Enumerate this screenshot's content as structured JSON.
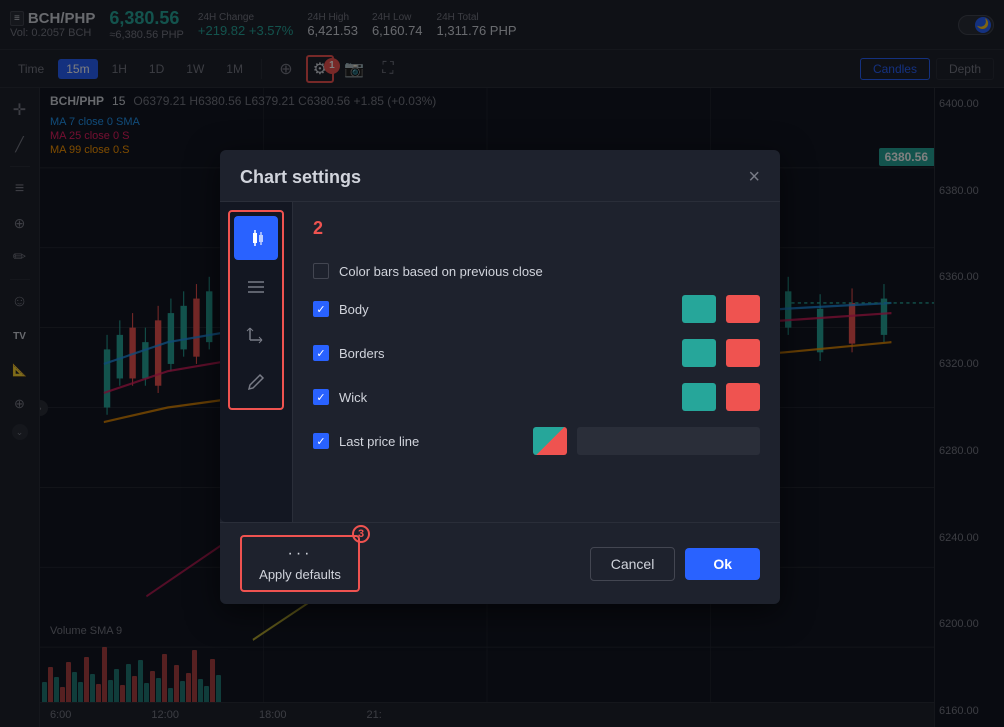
{
  "topbar": {
    "symbol_icon": "≡",
    "symbol": "BCH/PHP",
    "volume": "Vol: 0.2057 BCH",
    "price": "6,380.56",
    "price_approx": "≈6,380.56 PHP",
    "change_24h_label": "24H Change",
    "change_24h_value": "+219.82",
    "change_24h_pct": "+3.57%",
    "high_label": "24H High",
    "high_value": "6,421.53",
    "low_label": "24H Low",
    "low_value": "6,160.74",
    "total_label": "24H Total",
    "total_value": "1,311.76 PHP"
  },
  "toolbar": {
    "times": [
      "Time",
      "15m",
      "1H",
      "1D",
      "1W",
      "1M"
    ],
    "active_time": "15m",
    "candles_label": "Candles",
    "depth_label": "Depth"
  },
  "chart": {
    "pair": "BCH/PHP",
    "interval": "15",
    "ohlc": "O6379.21  H6380.56  L6379.21  C6380.56  +1.85 (+0.03%)",
    "ma7": "MA 7 close 0 SMA",
    "ma25": "MA 25 close 0 S",
    "ma99": "MA 99 close 0.S",
    "price_badge": "6380.56",
    "price_levels": [
      "6400.00",
      "6380.00",
      "6360.00",
      "6320.00",
      "6280.00",
      "6240.00",
      "6200.00",
      "6160.00"
    ],
    "time_labels": [
      "6:00",
      "12:00",
      "18:00",
      "21:"
    ],
    "volume_label": "Volume SMA 9",
    "watermark": "TV"
  },
  "modal": {
    "title": "Chart settings",
    "close_label": "×",
    "tabs": [
      {
        "id": "candles",
        "icon": "candle",
        "active": true
      },
      {
        "id": "lines",
        "icon": "lines",
        "active": false
      },
      {
        "id": "axes",
        "icon": "axes",
        "active": false
      },
      {
        "id": "pencil",
        "icon": "pencil",
        "active": false
      }
    ],
    "section_number": "2",
    "color_bars_label": "Color bars based on previous close",
    "color_bars_checked": false,
    "rows": [
      {
        "id": "body",
        "label": "Body",
        "checked": true,
        "color1": "green",
        "color2": "red"
      },
      {
        "id": "borders",
        "label": "Borders",
        "checked": true,
        "color1": "green",
        "color2": "red"
      },
      {
        "id": "wick",
        "label": "Wick",
        "checked": true,
        "color1": "green",
        "color2": "red"
      },
      {
        "id": "last_price",
        "label": "Last price line",
        "checked": true,
        "color1": "teal-red",
        "color2": "line"
      }
    ],
    "footer": {
      "apply_defaults_dots": "···",
      "apply_defaults_label": "Apply defaults",
      "cancel_label": "Cancel",
      "ok_label": "Ok"
    },
    "badge1": "1",
    "badge2": "2",
    "badge3": "3"
  },
  "left_sidebar": {
    "tools": [
      {
        "id": "crosshair",
        "icon": "+"
      },
      {
        "id": "trend-line",
        "icon": "/"
      },
      {
        "id": "horizontal-line",
        "icon": "—"
      },
      {
        "id": "measure",
        "icon": "↔"
      },
      {
        "id": "pencil",
        "icon": "✎"
      },
      {
        "id": "emoji",
        "icon": "☺"
      },
      {
        "id": "watermark",
        "icon": "TV"
      },
      {
        "id": "ruler",
        "icon": "📏"
      },
      {
        "id": "zoom",
        "icon": "🔍"
      },
      {
        "id": "magnet",
        "icon": "⚓"
      }
    ]
  }
}
